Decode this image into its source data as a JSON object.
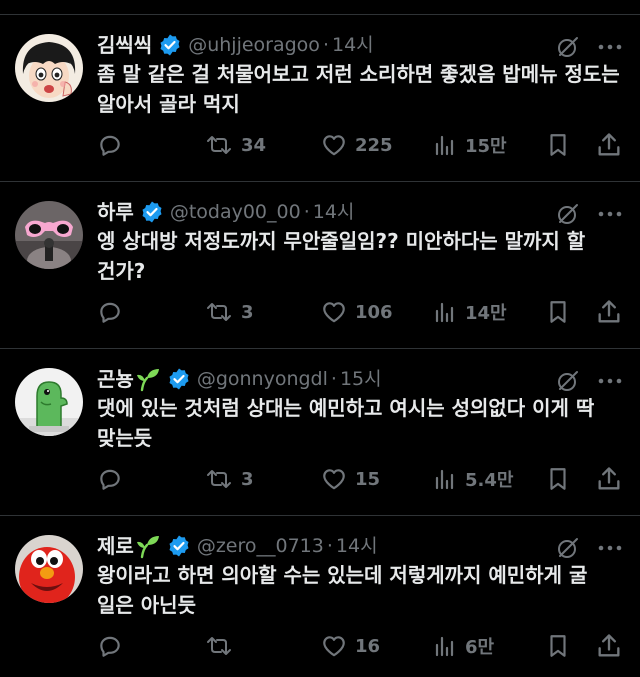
{
  "colors": {
    "background": "#000000",
    "text_primary": "#e7e9ea",
    "text_secondary": "#71767b",
    "divider": "#2f3336",
    "verified_blue": "#1d9bf0",
    "sprout_green": "#7ed957"
  },
  "tweets": [
    {
      "name": "김씩씩",
      "handle": "@uhjjeoragoo",
      "dot": "·",
      "time": "14시",
      "text": "좀 말 같은 걸 처물어보고 저런 소리하면 좋겠음 밥메뉴 정도는 알아서 골라 먹지",
      "replies": "",
      "retweets": "34",
      "likes": "225",
      "views": "15만",
      "avatar_icon": "cartoon-girl-avatar",
      "has_sprout": false
    },
    {
      "name": "하루",
      "handle": "@today00_00",
      "dot": "·",
      "time": "14시",
      "text": "엥 상대방 저정도까지 무안줄일임?? 미안하다는 말까지 할 건가?",
      "replies": "",
      "retweets": "3",
      "likes": "106",
      "views": "14만",
      "avatar_icon": "pink-sunglasses-avatar",
      "has_sprout": false
    },
    {
      "name": "곤뇽",
      "handle": "@gonnyongdl",
      "dot": "·",
      "time": "15시",
      "text": "댓에 있는 것처럼 상대는 예민하고 여시는 성의없다 이게 딱 맞는듯",
      "replies": "",
      "retweets": "3",
      "likes": "15",
      "views": "5.4만",
      "avatar_icon": "green-dino-avatar",
      "has_sprout": true
    },
    {
      "name": "제로",
      "handle": "@zero__0713",
      "dot": "·",
      "time": "14시",
      "text": "왕이라고 하면 의아할 수는 있는데 저렇게까지 예민하게 굴 일은 아닌듯",
      "replies": "",
      "retweets": "",
      "likes": "16",
      "views": "6만",
      "avatar_icon": "red-puppet-avatar",
      "has_sprout": true
    }
  ],
  "icons": {
    "verified": "verified-badge-icon",
    "sprout": "sprout-icon",
    "grok": "grok-icon",
    "more": "more-icon",
    "reply": "reply-icon",
    "retweet": "retweet-icon",
    "like": "heart-icon",
    "views": "views-icon",
    "bookmark": "bookmark-icon",
    "share": "share-icon"
  }
}
